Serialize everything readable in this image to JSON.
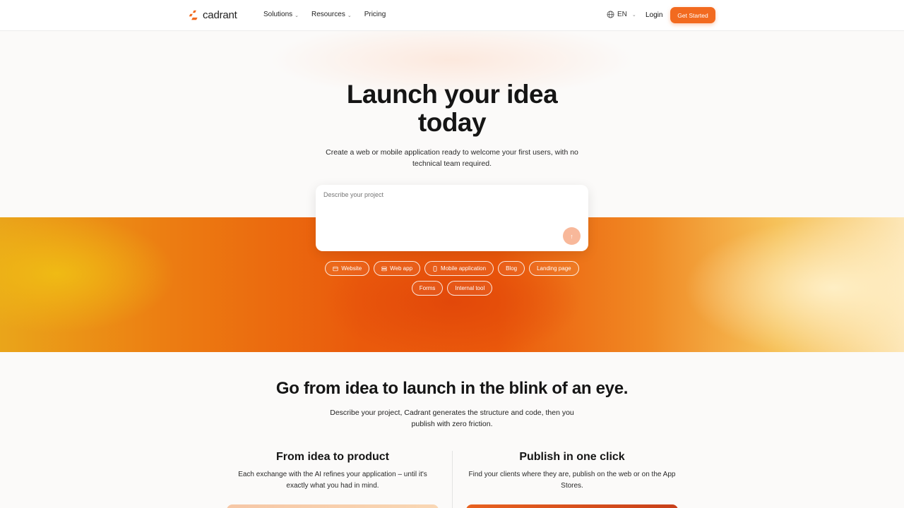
{
  "header": {
    "brand": "cadrant",
    "nav": [
      {
        "label": "Solutions",
        "has_dropdown": true
      },
      {
        "label": "Resources",
        "has_dropdown": true
      },
      {
        "label": "Pricing",
        "has_dropdown": false
      }
    ],
    "language": "EN",
    "login_label": "Login",
    "cta_label": "Get Started"
  },
  "hero": {
    "title_line1": "Launch your idea",
    "title_line2": "today",
    "subtitle": "Create a web or mobile application ready to welcome your first users, with no technical team required.",
    "prompt_placeholder": "Describe your project",
    "chips_row1": [
      "Website",
      "Web app",
      "Mobile application",
      "Blog",
      "Landing page"
    ],
    "chips_row2": [
      "Forms",
      "Internal tool"
    ]
  },
  "section2": {
    "title": "Go from idea to launch in the blink of an eye.",
    "subtitle": "Describe your project, Cadrant generates the structure and code, then you publish with zero friction.",
    "col_left_title": "From idea to product",
    "col_left_text": "Each exchange with the AI refines your application – until it's exactly what you had in mind.",
    "col_right_title": "Publish in one click",
    "col_right_text": "Find your clients where they are, publish on the web or on the App Stores."
  },
  "colors": {
    "accent": "#f26a1f",
    "band_mid": "#ea5a0c",
    "band_left": "#eaa51a",
    "band_right": "#fde7b8"
  },
  "icons": {
    "logo": "cadrant-logo-icon",
    "language": "globe-icon",
    "send": "arrow-up-icon"
  }
}
